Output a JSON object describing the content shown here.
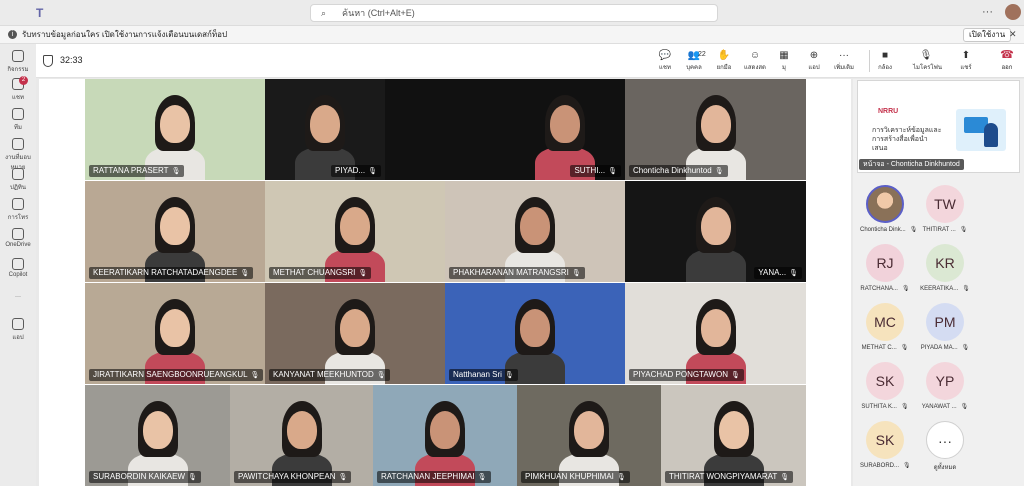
{
  "app": {
    "search_placeholder": "ค้นหา (Ctrl+Alt+E)",
    "dots": "···"
  },
  "banner": {
    "text": "รับทราบข้อมูลก่อนใคร เปิดใช้งานการแจ้งเตือนบนเดสก์ท็อป",
    "open_label": "เปิดใช้งาน",
    "close": "✕"
  },
  "rail": [
    {
      "label": "กิจกรรม",
      "icon": "bell-icon"
    },
    {
      "label": "แชท",
      "icon": "chat-icon",
      "badge": "2"
    },
    {
      "label": "ทีม",
      "icon": "teams-icon"
    },
    {
      "label": "งานที่มอบหมาย",
      "icon": "assignments-icon"
    },
    {
      "label": "ปฏิทิน",
      "icon": "calendar-icon"
    },
    {
      "label": "การโทร",
      "icon": "phone-icon"
    },
    {
      "label": "OneDrive",
      "icon": "onedrive-icon"
    },
    {
      "label": "Copilot",
      "icon": "copilot-icon"
    },
    {
      "label": "···",
      "icon": "more-icon"
    },
    {
      "label": "แอป",
      "icon": "apps-icon"
    }
  ],
  "meeting": {
    "timer": "32:33",
    "toolbar": [
      {
        "label": "แชท",
        "icon": "chat-icon",
        "glyph": "💬"
      },
      {
        "label": "บุคคล",
        "icon": "people-icon",
        "glyph": "👥",
        "count": "22"
      },
      {
        "label": "ยกมือ",
        "icon": "raise-hand-icon",
        "glyph": "✋"
      },
      {
        "label": "แสดงสด",
        "icon": "react-icon",
        "glyph": "☺"
      },
      {
        "label": "มุ",
        "icon": "view-icon",
        "glyph": "▦"
      },
      {
        "label": "แอป",
        "icon": "add-app-icon",
        "glyph": "⊕"
      },
      {
        "label": "เพิ่มเติม",
        "icon": "more-icon",
        "glyph": "···"
      },
      {
        "label": "กล้อง",
        "icon": "camera-icon",
        "glyph": "■"
      },
      {
        "label": "ไมโครโฟน",
        "icon": "mic-off-icon",
        "glyph": "🎙"
      },
      {
        "label": "แชร์",
        "icon": "share-icon",
        "glyph": "⬆"
      }
    ],
    "leave_label": "ออก"
  },
  "tiles": [
    {
      "name": "RATTANA  PRASERT",
      "bg": "#c7d9b8"
    },
    {
      "name": "PIYAD...",
      "bg": "#1a1a1a"
    },
    {
      "name": "SUTHI...",
      "bg": "#111111"
    },
    {
      "name": "Chonticha Dinkhuntod",
      "bg": "#6a6560"
    },
    {
      "name": "KEERATIKARN RATCHATADAENGDEE",
      "bg": "#b9a894"
    },
    {
      "name": "METHAT CHUANGSRI",
      "bg": "#cfc7b4"
    },
    {
      "name": "PHAKHARANAN MATRANGSRI",
      "bg": "#cec4b8"
    },
    {
      "name": "YANA...",
      "bg": "#151515"
    },
    {
      "name": "JIRATTIKARN SAENGBOONRUEANGKUL",
      "bg": "#b8a995"
    },
    {
      "name": "KANYANAT MEEKHUNTOD",
      "bg": "#7a6a5e"
    },
    {
      "name": "Natthanan Sri",
      "bg": "#3b63b8"
    },
    {
      "name": "PIYACHAD PONGTAWON",
      "bg": "#e1ded9"
    },
    {
      "name": "SURABORDIN KAIKAEW",
      "bg": "#9c9a94"
    },
    {
      "name": "PAWITCHAYA KHONPEAN",
      "bg": "#b3aea5"
    },
    {
      "name": "RATCHANAN JEEPHIMAI",
      "bg": "#8fa8b8"
    },
    {
      "name": "PIMKHUAN KHUPHIMAI",
      "bg": "#6e6a60"
    },
    {
      "name": "THITIRAT WONGPIYAMARAT",
      "bg": "#cbc6be"
    }
  ],
  "shared": {
    "logo": "NRRU",
    "text": "การวิเคราะห์ข้อมูลและการสร้างสื่อเพื่อนำเสนอ",
    "caption": "หน้าจอ - Chonticha Dinkhuntod"
  },
  "people": [
    {
      "initials": "",
      "name": "Chonticha Dink...",
      "color": "#8a7158",
      "photo": true
    },
    {
      "initials": "TW",
      "name": "THITIRAT ...",
      "color": "#f3d6dc"
    },
    {
      "initials": "RJ",
      "name": "RATCHANA...",
      "color": "#f1d2da"
    },
    {
      "initials": "KR",
      "name": "KEERATIKA...",
      "color": "#dbe8d3"
    },
    {
      "initials": "MC",
      "name": "METHAT C...",
      "color": "#f6e3bd"
    },
    {
      "initials": "PM",
      "name": "PIYADA MA...",
      "color": "#d4dcf2"
    },
    {
      "initials": "SK",
      "name": "SUTHITA K...",
      "color": "#f3d6dc"
    },
    {
      "initials": "YP",
      "name": "YANAWAT ...",
      "color": "#f3d6dc"
    },
    {
      "initials": "SK",
      "name": "SURABORD...",
      "color": "#f6e3bd"
    },
    {
      "initials": "···",
      "name": "ดูทั้งหมด",
      "color": "#ffffff",
      "more": true
    }
  ]
}
